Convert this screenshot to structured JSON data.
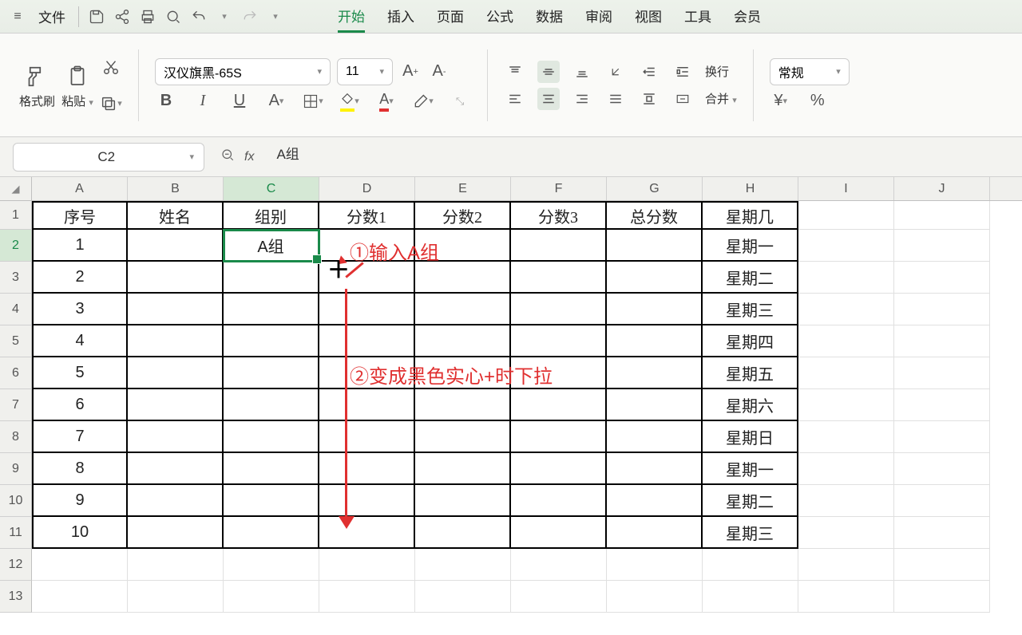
{
  "menubar": {
    "file": "文件",
    "tabs": [
      "开始",
      "插入",
      "页面",
      "公式",
      "数据",
      "审阅",
      "视图",
      "工具",
      "会员"
    ],
    "active_tab": "开始"
  },
  "ribbon": {
    "format_brush": "格式刷",
    "paste": "粘贴",
    "font_name": "汉仪旗黑-65S",
    "font_size": "11",
    "wrap": "换行",
    "merge": "合并",
    "number_format": "常规",
    "currency": "¥",
    "percent": "%"
  },
  "formula_bar": {
    "name_box": "C2",
    "fx": "fx",
    "formula": "A组"
  },
  "sheet": {
    "columns": [
      "A",
      "B",
      "C",
      "D",
      "E",
      "F",
      "G",
      "H",
      "I",
      "J"
    ],
    "row_numbers": [
      "1",
      "2",
      "3",
      "4",
      "5",
      "6",
      "7",
      "8",
      "9",
      "10",
      "11",
      "12",
      "13"
    ],
    "headers": [
      "序号",
      "姓名",
      "组别",
      "分数1",
      "分数2",
      "分数3",
      "总分数",
      "星期几"
    ],
    "rows": [
      {
        "num": "1",
        "group": "A组",
        "day": "星期一"
      },
      {
        "num": "2",
        "group": "",
        "day": "星期二"
      },
      {
        "num": "3",
        "group": "",
        "day": "星期三"
      },
      {
        "num": "4",
        "group": "",
        "day": "星期四"
      },
      {
        "num": "5",
        "group": "",
        "day": "星期五"
      },
      {
        "num": "6",
        "group": "",
        "day": "星期六"
      },
      {
        "num": "7",
        "group": "",
        "day": "星期日"
      },
      {
        "num": "8",
        "group": "",
        "day": "星期一"
      },
      {
        "num": "9",
        "group": "",
        "day": "星期二"
      },
      {
        "num": "10",
        "group": "",
        "day": "星期三"
      }
    ]
  },
  "annotations": {
    "step1": "①输入A组",
    "step2": "②变成黑色实心+时下拉"
  }
}
